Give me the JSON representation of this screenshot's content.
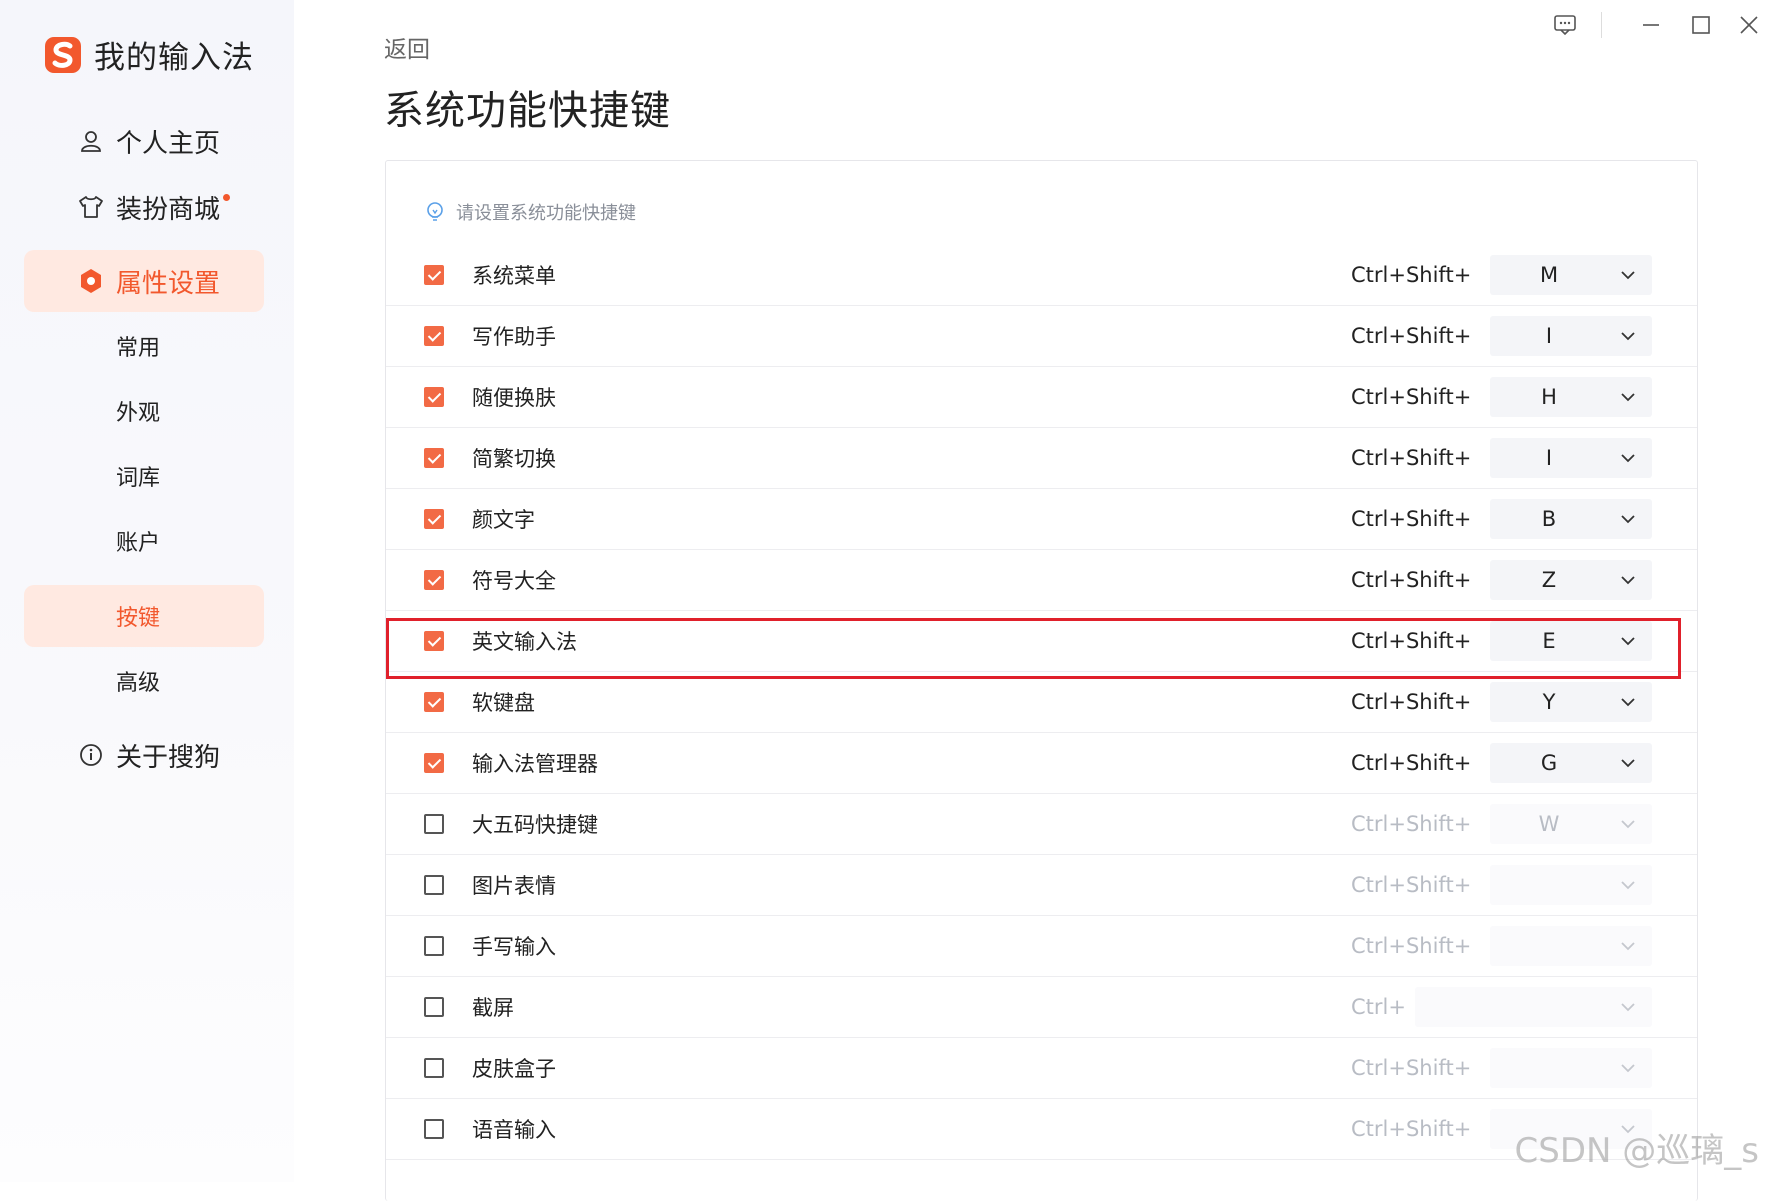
{
  "sidebar": {
    "app_title": "我的输入法",
    "nav": [
      {
        "label": "个人主页",
        "icon": "user-icon"
      },
      {
        "label": "装扮商城",
        "icon": "shirt-icon",
        "has_dot": true
      },
      {
        "label": "属性设置",
        "icon": "hexagon-settings-icon",
        "active": true
      },
      {
        "label": "关于搜狗",
        "icon": "info-icon"
      }
    ],
    "sub_nav": [
      {
        "label": "常用"
      },
      {
        "label": "外观"
      },
      {
        "label": "词库"
      },
      {
        "label": "账户"
      },
      {
        "label": "按键",
        "active": true
      },
      {
        "label": "高级"
      }
    ]
  },
  "header": {
    "back_label": "返回",
    "title": "系统功能快捷键"
  },
  "panel": {
    "hint": "请设置系统功能快捷键",
    "rows": [
      {
        "label": "系统菜单",
        "checked": true,
        "prefix": "Ctrl+Shift+",
        "key": "M"
      },
      {
        "label": "写作助手",
        "checked": true,
        "prefix": "Ctrl+Shift+",
        "key": "I"
      },
      {
        "label": "随便换肤",
        "checked": true,
        "prefix": "Ctrl+Shift+",
        "key": "H"
      },
      {
        "label": "简繁切换",
        "checked": true,
        "prefix": "Ctrl+Shift+",
        "key": "I"
      },
      {
        "label": "颜文字",
        "checked": true,
        "prefix": "Ctrl+Shift+",
        "key": "B"
      },
      {
        "label": "符号大全",
        "checked": true,
        "prefix": "Ctrl+Shift+",
        "key": "Z"
      },
      {
        "label": "英文输入法",
        "checked": true,
        "prefix": "Ctrl+Shift+",
        "key": "E",
        "highlighted": true
      },
      {
        "label": "软键盘",
        "checked": true,
        "prefix": "Ctrl+Shift+",
        "key": "Y"
      },
      {
        "label": "输入法管理器",
        "checked": true,
        "prefix": "Ctrl+Shift+",
        "key": "G"
      },
      {
        "label": "大五码快捷键",
        "checked": false,
        "prefix": "Ctrl+Shift+",
        "key": "W"
      },
      {
        "label": "图片表情",
        "checked": false,
        "prefix": "Ctrl+Shift+",
        "key": ""
      },
      {
        "label": "手写输入",
        "checked": false,
        "prefix": "Ctrl+Shift+",
        "key": ""
      },
      {
        "label": "截屏",
        "checked": false,
        "prefix": "Ctrl+",
        "key": ""
      },
      {
        "label": "皮肤盒子",
        "checked": false,
        "prefix": "Ctrl+Shift+",
        "key": ""
      },
      {
        "label": "语音输入",
        "checked": false,
        "prefix": "Ctrl+Shift+",
        "key": ""
      }
    ]
  },
  "window_controls": [
    "feedback-icon",
    "minimize-icon",
    "maximize-icon",
    "close-icon"
  ],
  "watermark": "CSDN @巡璃_s",
  "colors": {
    "accent": "#f2582d",
    "active_bg": "#ffe9e1",
    "highlight_border": "#e0202b"
  }
}
